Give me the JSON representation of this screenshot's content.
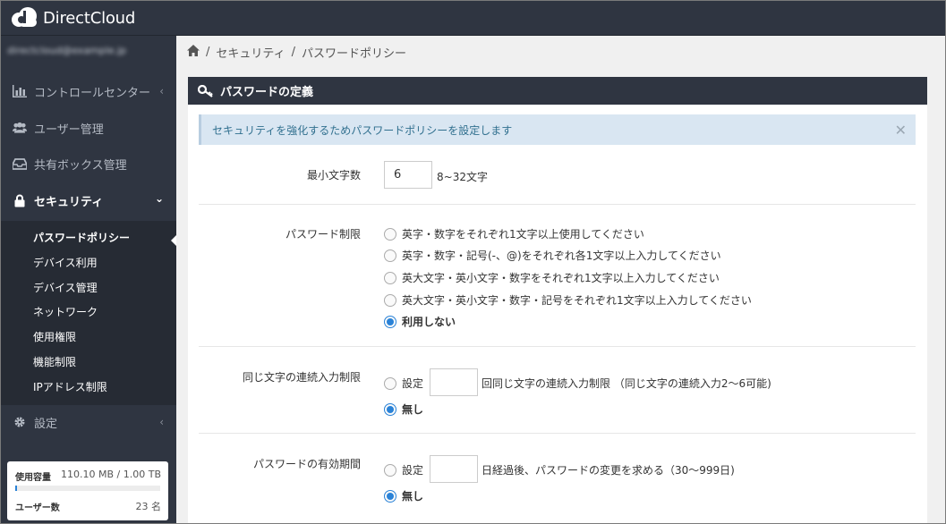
{
  "app": {
    "name": "DirectCloud"
  },
  "sidebar": {
    "user_email": "directcloud@example.jp",
    "items": [
      {
        "label": "コントロールセンター",
        "icon": "bar-chart-icon"
      },
      {
        "label": "ユーザー管理",
        "icon": "users-icon"
      },
      {
        "label": "共有ボックス管理",
        "icon": "inbox-icon"
      },
      {
        "label": "セキュリティ",
        "icon": "lock-icon"
      },
      {
        "label": "設定",
        "icon": "gear-icon"
      }
    ],
    "security_sub": [
      "パスワードポリシー",
      "デバイス利用",
      "デバイス管理",
      "ネットワーク",
      "使用権限",
      "機能制限",
      "IPアドレス制限"
    ],
    "usage": {
      "capacity_label": "使用容量",
      "capacity_value": "110.10 MB / 1.00 TB",
      "capacity_fraction": 0.0001,
      "users_label": "ユーザー数",
      "users_value": "23 名"
    }
  },
  "breadcrumb": {
    "separator": "/",
    "items": [
      "セキュリティ",
      "パスワードポリシー"
    ]
  },
  "panel": {
    "title": "パスワードの定義",
    "info": "セキュリティを強化するためパスワードポリシーを設定します",
    "min_length": {
      "label": "最小文字数",
      "value": "6",
      "hint": "8~32文字"
    },
    "restriction": {
      "label": "パスワード制限",
      "options": [
        "英字・数字をそれぞれ1文字以上使用してください",
        "英字・数字・記号(-、@)をそれぞれ各1文字以上入力してください",
        "英大文字・英小文字・数字をそれぞれ1文字以上入力してください",
        "英大文字・英小文字・数字・記号をそれぞれ1文字以上入力してください",
        "利用しない"
      ],
      "selected_index": 4
    },
    "repeat": {
      "label": "同じ文字の連続入力制限",
      "set_label": "設定",
      "input_value": "",
      "suffix": "回同じ文字の連続入力制限 （同じ文字の連続入力2～6可能)",
      "none_label": "無し"
    },
    "expiry": {
      "label": "パスワードの有効期間",
      "set_label": "設定",
      "input_value": "",
      "suffix": "日経過後、パスワードの変更を求める（30～999日)",
      "none_label": "無し"
    }
  }
}
